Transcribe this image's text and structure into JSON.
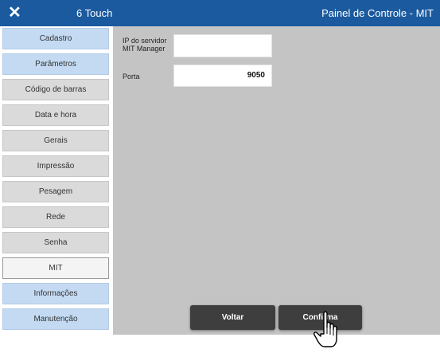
{
  "titlebar": {
    "close_glyph": "✕",
    "app_name": "6 Touch",
    "panel_title": "Painel de Controle - MIT"
  },
  "sidebar": {
    "items": [
      {
        "label": "Cadastro"
      },
      {
        "label": "Parâmetros"
      },
      {
        "label": "Código de barras"
      },
      {
        "label": "Data e hora"
      },
      {
        "label": "Gerais"
      },
      {
        "label": "Impressão"
      },
      {
        "label": "Pesagem"
      },
      {
        "label": "Rede"
      },
      {
        "label": "Senha"
      },
      {
        "label": "MIT"
      },
      {
        "label": "Informações"
      },
      {
        "label": "Manutenção"
      }
    ],
    "active": "MIT"
  },
  "form": {
    "server_label": "IP do servidor MIT Manager",
    "server_label_line1": "IP do servidor",
    "server_label_line2": "MIT Manager",
    "server_value": "",
    "port_label": "Porta",
    "port_value": "9050"
  },
  "buttons": {
    "back_label": "Voltar",
    "confirm_label": "Confirma"
  },
  "colors": {
    "titlebar": "#1b5a9f",
    "sidebar_blue": "#c3daf2",
    "sidebar_gray": "#dadada",
    "content_bg": "#c4c4c4",
    "button_bg": "#3e3e3e"
  },
  "icons": {
    "close": "close-icon",
    "pointer": "hand-pointer-icon"
  }
}
